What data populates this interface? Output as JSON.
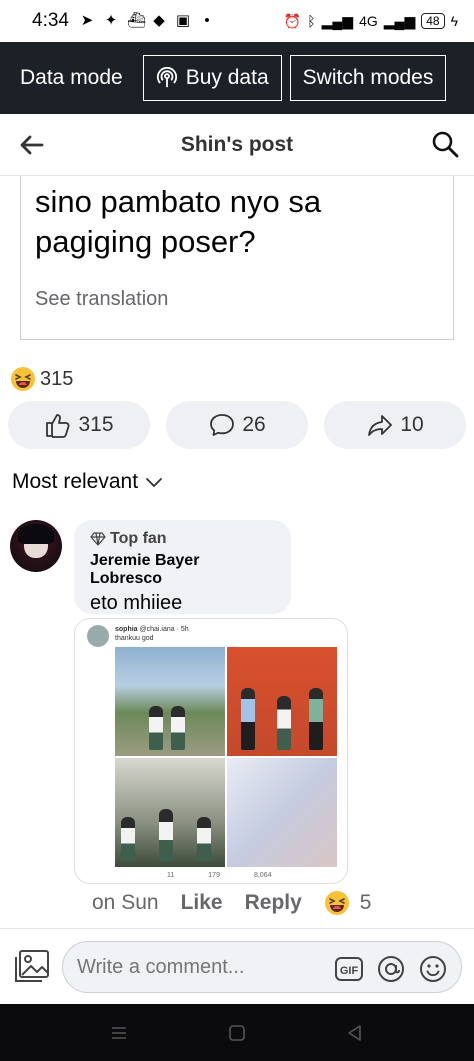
{
  "status_bar": {
    "time": "4:34",
    "network": "4G",
    "battery": "48"
  },
  "data_bar": {
    "label": "Data mode",
    "buy_data": "Buy data",
    "switch_modes": "Switch modes"
  },
  "header": {
    "title": "Shin's post"
  },
  "post": {
    "text": "sino pambato nyo sa pagiging poser?",
    "see_translation": "See translation"
  },
  "reactions": {
    "count": "315"
  },
  "actions": {
    "like_count": "315",
    "comment_count": "26",
    "share_count": "10"
  },
  "sort": {
    "label": "Most relevant"
  },
  "comment": {
    "badge": "Top fan",
    "author": "Jeremie Bayer Lobresco",
    "text": "eto mhiiee",
    "time": "on Sun",
    "like": "Like",
    "reply": "Reply",
    "reaction_count": "5",
    "image": {
      "user": "sophia",
      "handle": "@chai.iana · 5h",
      "caption": "thankuu god",
      "retweets": "11",
      "likes": "179",
      "views": "8,064"
    }
  },
  "composer": {
    "placeholder": "Write a comment..."
  }
}
